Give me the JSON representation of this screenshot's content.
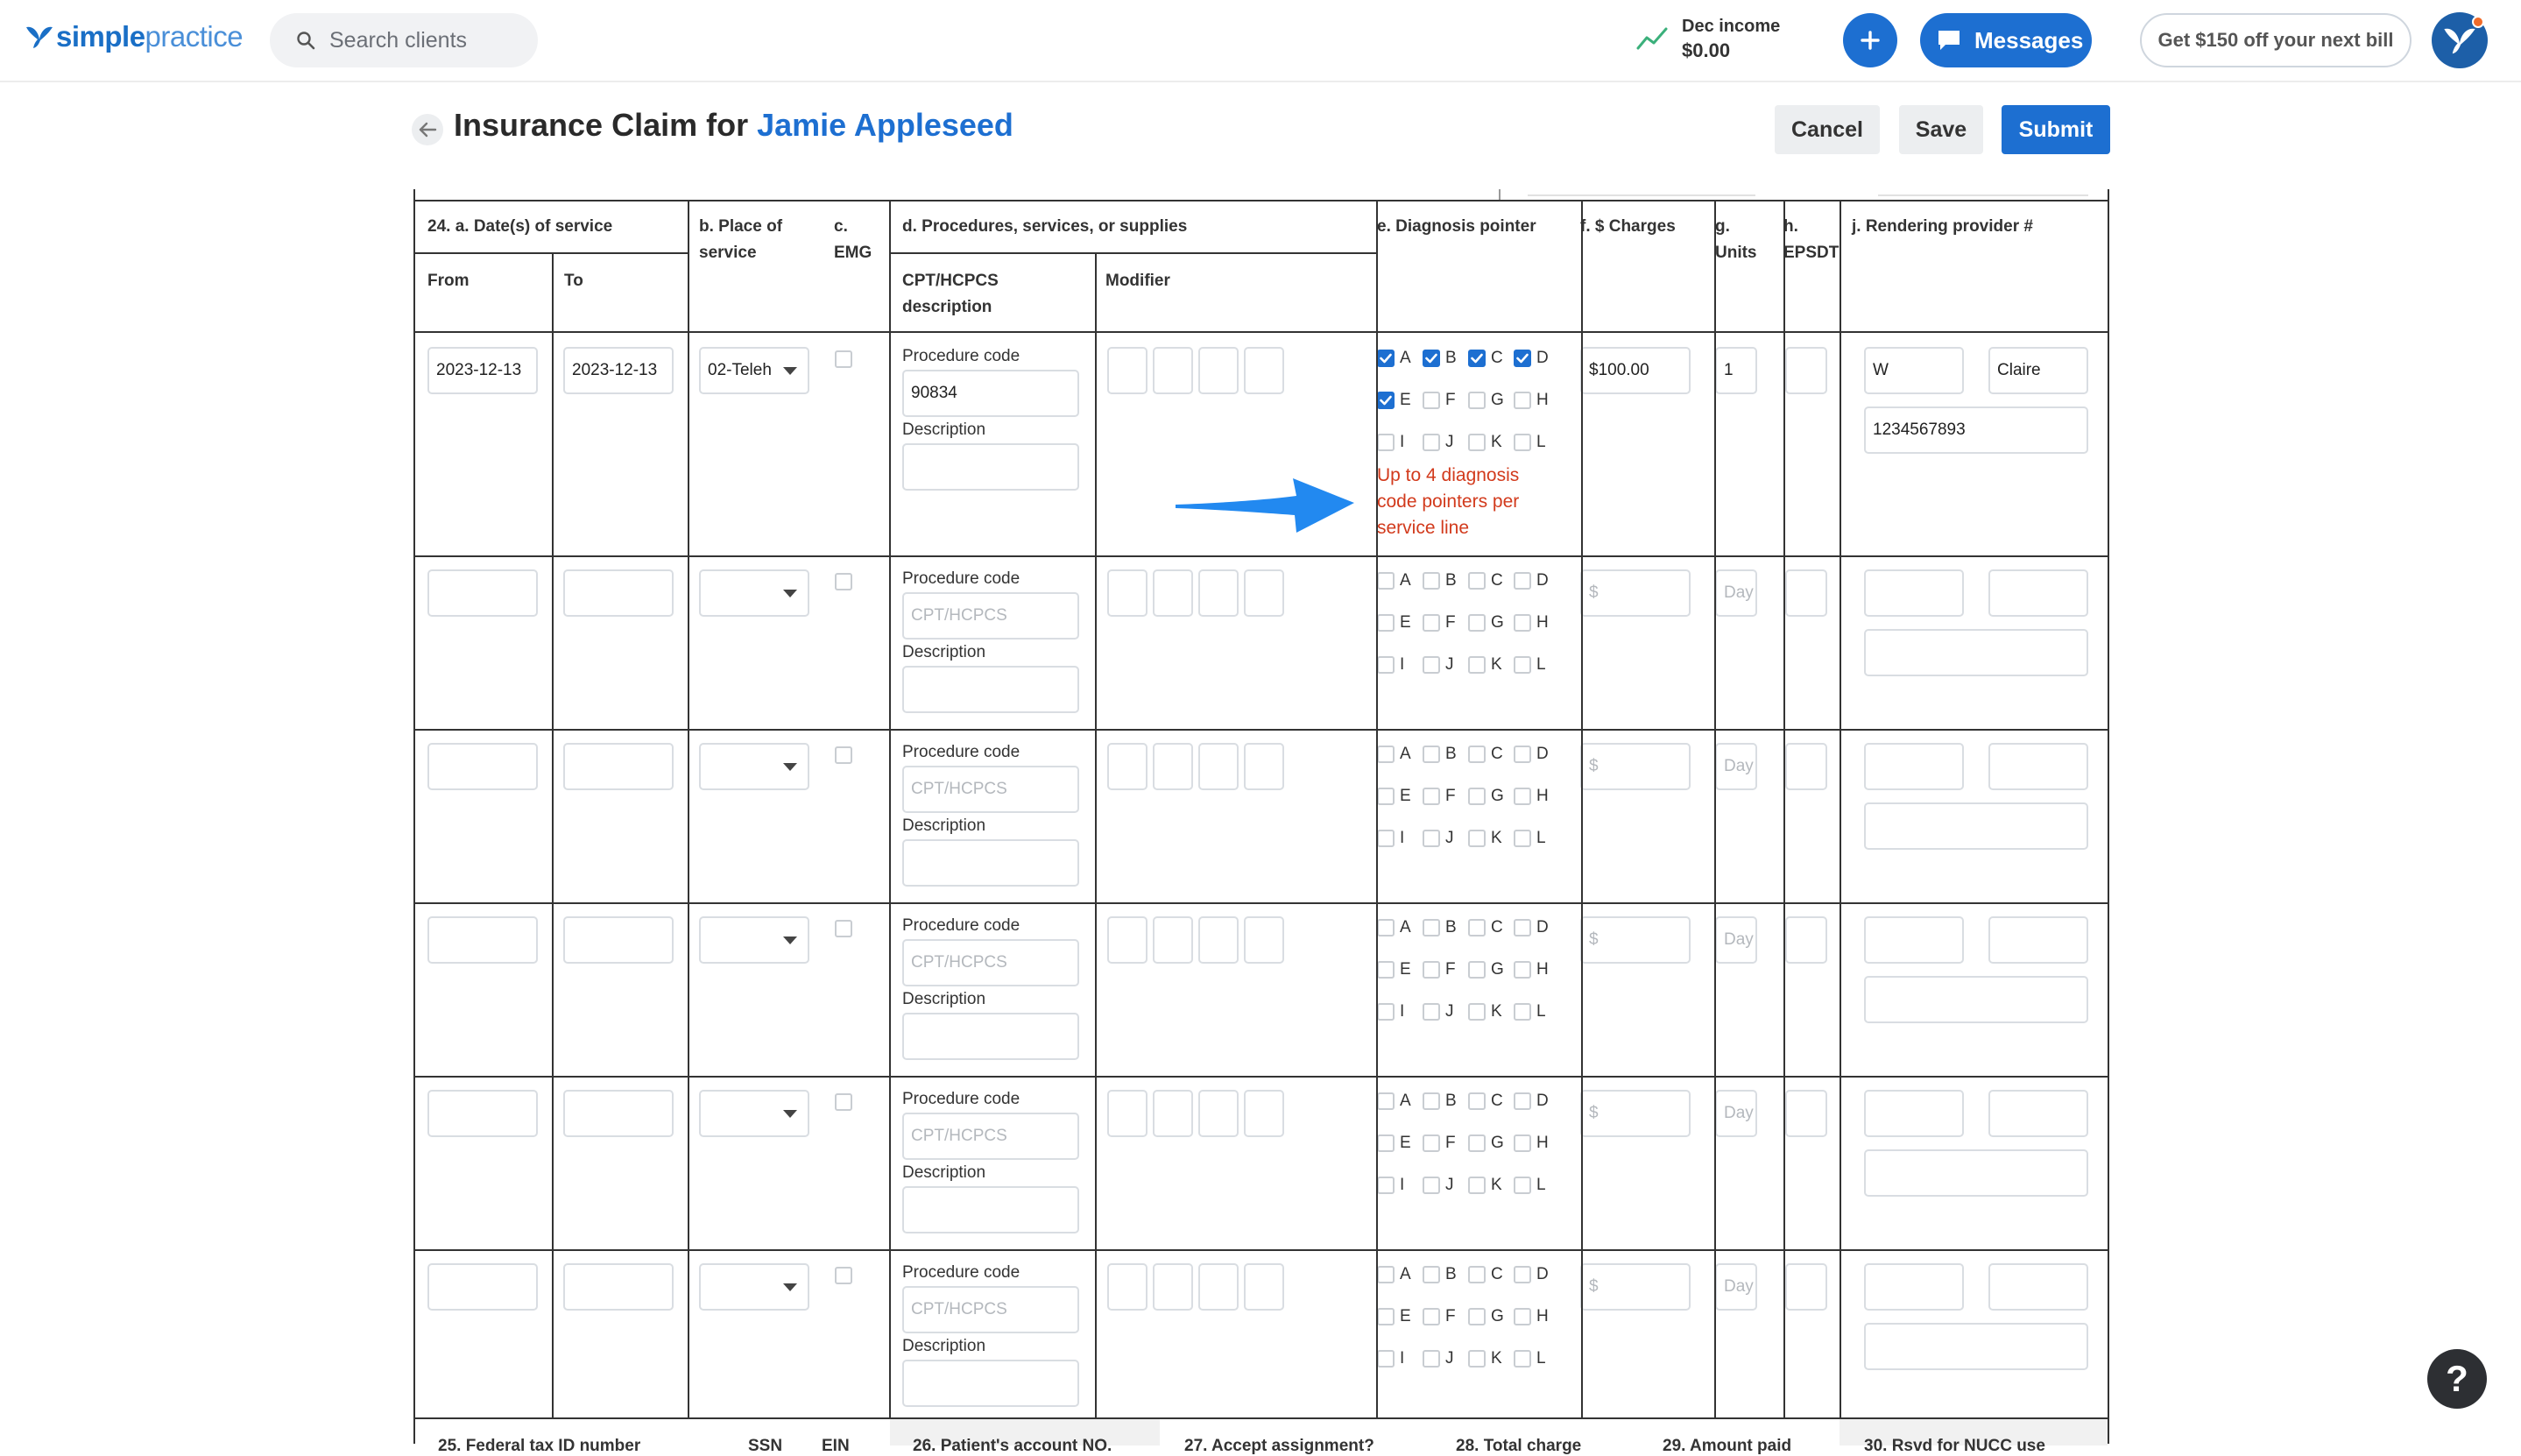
{
  "brand": {
    "logo_bold": "simple",
    "logo_light": "practice"
  },
  "search": {
    "placeholder": "Search clients"
  },
  "income": {
    "label": "Dec income",
    "value": "$0.00"
  },
  "header": {
    "messages": "Messages",
    "promo": "Get $150 off your next bill"
  },
  "page": {
    "title_prefix": "Insurance Claim for ",
    "client_name": "Jamie Appleseed",
    "cancel": "Cancel",
    "save": "Save",
    "submit": "Submit"
  },
  "columns": {
    "date_of_service": "24. a. Date(s) of service",
    "from": "From",
    "to": "To",
    "place_of_service": "b. Place of service",
    "emg": "c. EMG",
    "procedures": "d. Procedures, services, or supplies",
    "cpt_description": "CPT/HCPCS description",
    "modifier": "Modifier",
    "diagnosis_pointer": "e. Diagnosis pointer",
    "charges": "f. $ Charges",
    "units": "g. Units",
    "epsdt": "h. EPSDT",
    "rendering_provider": "j. Rendering provider #"
  },
  "labels": {
    "procedure_code": "Procedure code",
    "description": "Description"
  },
  "placeholders": {
    "cpt": "CPT/HCPCS",
    "charge": "$",
    "units": "Day"
  },
  "diagnosis_letters": [
    "A",
    "B",
    "C",
    "D",
    "E",
    "F",
    "G",
    "H",
    "I",
    "J",
    "K",
    "L"
  ],
  "service_lines": [
    {
      "from": "2023-12-13",
      "to": "2023-12-13",
      "place": "02-Teleh",
      "procedure_code": "90834",
      "charge": "$100.00",
      "units": "1",
      "provider_first": "W",
      "provider_last": "Claire",
      "provider_npi": "1234567893",
      "pointers": [
        "A",
        "B",
        "C",
        "D",
        "E"
      ]
    },
    {
      "from": "",
      "to": "",
      "place": "",
      "procedure_code": "",
      "charge": "",
      "units": "",
      "provider_first": "",
      "provider_last": "",
      "provider_npi": "",
      "pointers": []
    },
    {
      "from": "",
      "to": "",
      "place": "",
      "procedure_code": "",
      "charge": "",
      "units": "",
      "provider_first": "",
      "provider_last": "",
      "provider_npi": "",
      "pointers": []
    },
    {
      "from": "",
      "to": "",
      "place": "",
      "procedure_code": "",
      "charge": "",
      "units": "",
      "provider_first": "",
      "provider_last": "",
      "provider_npi": "",
      "pointers": []
    },
    {
      "from": "",
      "to": "",
      "place": "",
      "procedure_code": "",
      "charge": "",
      "units": "",
      "provider_first": "",
      "provider_last": "",
      "provider_npi": "",
      "pointers": []
    },
    {
      "from": "",
      "to": "",
      "place": "",
      "procedure_code": "",
      "charge": "",
      "units": "",
      "provider_first": "",
      "provider_last": "",
      "provider_npi": "",
      "pointers": []
    }
  ],
  "annotation": {
    "note": "Up to 4 diagnosis code pointers per service line"
  },
  "footer": {
    "tax_id": "25. Federal tax ID number",
    "ssn": "SSN",
    "ein": "EIN",
    "patient_account": "26. Patient's account NO.",
    "accept_assignment": "27. Accept assignment?",
    "total_charge": "28. Total charge",
    "amount_paid": "29. Amount paid",
    "nucc": "30. Rsvd for NUCC use"
  },
  "help": {
    "label": "?"
  },
  "colors": {
    "accent": "#1d6fd1",
    "warning": "#d23a1c",
    "grid": "#333333"
  }
}
